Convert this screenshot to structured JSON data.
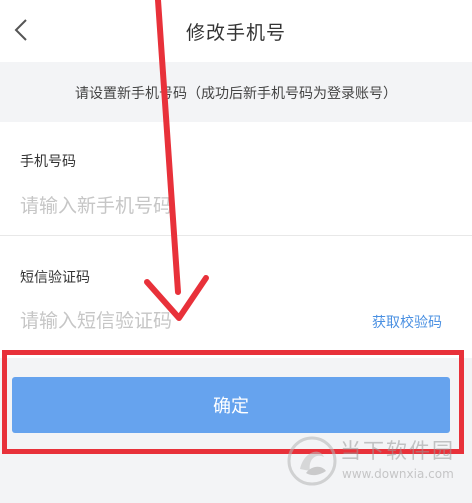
{
  "header": {
    "title": "修改手机号",
    "back_icon": "chevron-left-icon"
  },
  "info": {
    "text": "请设置新手机号码（成功后新手机号码为登录账号）"
  },
  "form": {
    "phone": {
      "label": "手机号码",
      "value": "",
      "placeholder": "请输入新手机号码"
    },
    "sms": {
      "label": "短信验证码",
      "value": "",
      "placeholder": "请输入短信验证码",
      "get_code_label": "获取校验码"
    }
  },
  "confirm": {
    "label": "确定"
  },
  "watermark": {
    "brand": "当下软件园",
    "url": "www.downxia.com"
  },
  "colors": {
    "primary_button": "#66a3ee",
    "link": "#4a90e2",
    "annotation": "#e8313a",
    "background": "#f3f4f6"
  }
}
